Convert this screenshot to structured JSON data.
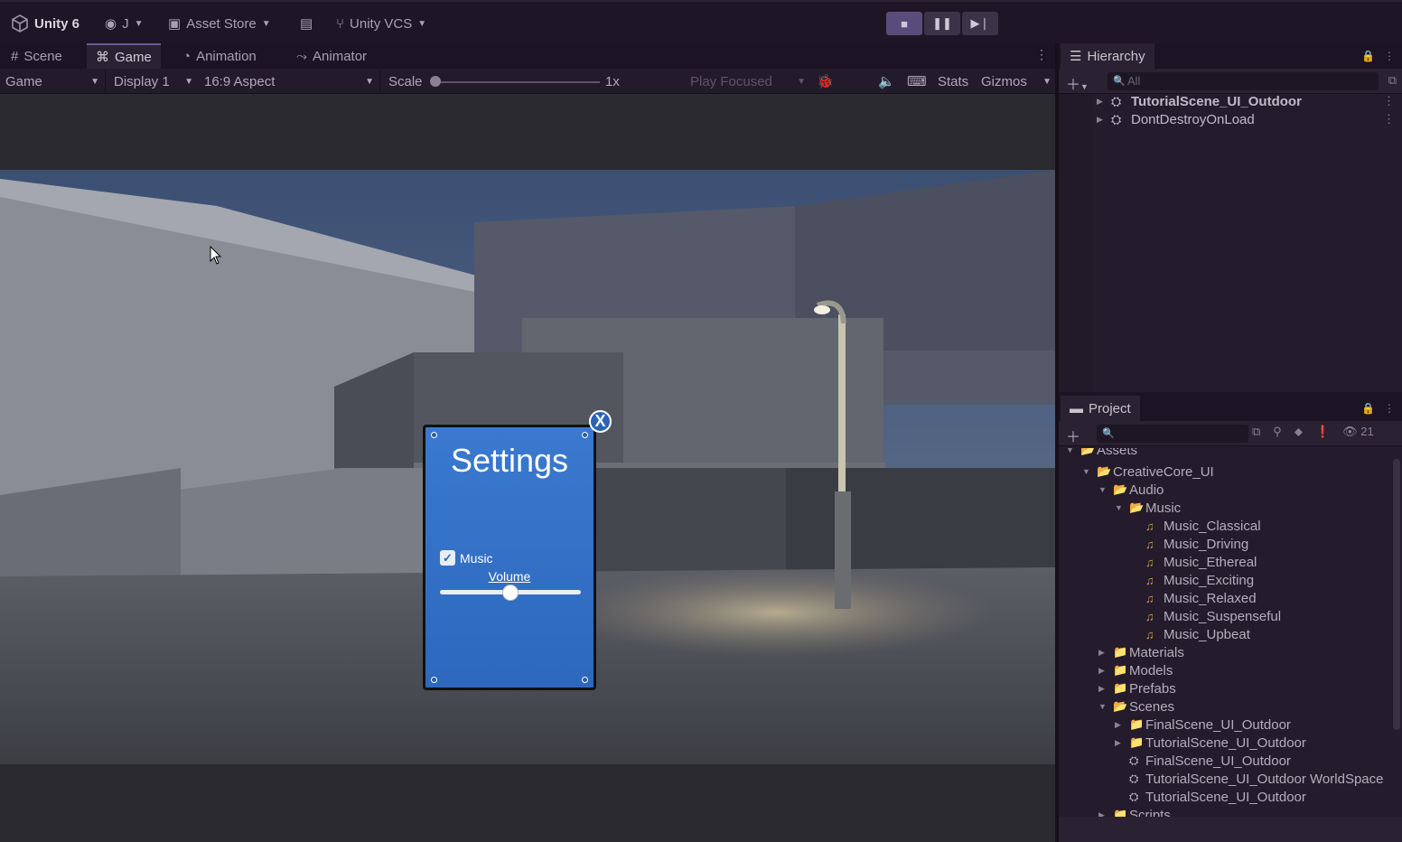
{
  "topbar": {
    "app": "Unity 6",
    "account": "J",
    "asset_store": "Asset Store",
    "vcs": "Unity VCS"
  },
  "game_tabs": {
    "scene": "Scene",
    "game": "Game",
    "animation": "Animation",
    "animator": "Animator"
  },
  "game_controls": {
    "view": "Game",
    "display": "Display 1",
    "aspect": "16:9 Aspect",
    "scale_label": "Scale",
    "scale_value": "1x",
    "play_focused": "Play Focused",
    "stats": "Stats",
    "gizmos": "Gizmos"
  },
  "settings_window": {
    "title": "Settings",
    "music_label": "Music",
    "music_checked": true,
    "volume_label": "Volume",
    "volume_value": 0.5,
    "close_label": "X"
  },
  "hierarchy": {
    "tab": "Hierarchy",
    "search_placeholder": "All",
    "items": [
      {
        "label": "TutorialScene_UI_Outdoor"
      },
      {
        "label": "DontDestroyOnLoad"
      }
    ]
  },
  "project": {
    "tab": "Project",
    "hidden_count": "21",
    "tree": [
      {
        "label": "Assets",
        "type": "folder-open",
        "depth": 0
      },
      {
        "label": "CreativeCore_UI",
        "type": "folder-open",
        "depth": 1
      },
      {
        "label": "Audio",
        "type": "folder-open",
        "depth": 2
      },
      {
        "label": "Music",
        "type": "folder-open",
        "depth": 3
      },
      {
        "label": "Music_Classical",
        "type": "audio",
        "depth": 4
      },
      {
        "label": "Music_Driving",
        "type": "audio",
        "depth": 4
      },
      {
        "label": "Music_Ethereal",
        "type": "audio",
        "depth": 4
      },
      {
        "label": "Music_Exciting",
        "type": "audio",
        "depth": 4
      },
      {
        "label": "Music_Relaxed",
        "type": "audio",
        "depth": 4
      },
      {
        "label": "Music_Suspenseful",
        "type": "audio",
        "depth": 4
      },
      {
        "label": "Music_Upbeat",
        "type": "audio",
        "depth": 4
      },
      {
        "label": "Materials",
        "type": "folder",
        "depth": 2
      },
      {
        "label": "Models",
        "type": "folder",
        "depth": 2
      },
      {
        "label": "Prefabs",
        "type": "folder",
        "depth": 2
      },
      {
        "label": "Scenes",
        "type": "folder-open",
        "depth": 2
      },
      {
        "label": "FinalScene_UI_Outdoor",
        "type": "folder",
        "depth": 3
      },
      {
        "label": "TutorialScene_UI_Outdoor",
        "type": "folder",
        "depth": 3
      },
      {
        "label": "FinalScene_UI_Outdoor",
        "type": "scene",
        "depth": 3
      },
      {
        "label": "TutorialScene_UI_Outdoor WorldSpace",
        "type": "scene",
        "depth": 3
      },
      {
        "label": "TutorialScene_UI_Outdoor",
        "type": "scene",
        "depth": 3
      },
      {
        "label": "Scripts",
        "type": "folder",
        "depth": 2
      }
    ]
  },
  "colors": {
    "editor_bg": "#1c1424",
    "settings_panel": "#3a79cf",
    "accent": "#5a4c7a",
    "audio_icon": "#c9a227"
  }
}
